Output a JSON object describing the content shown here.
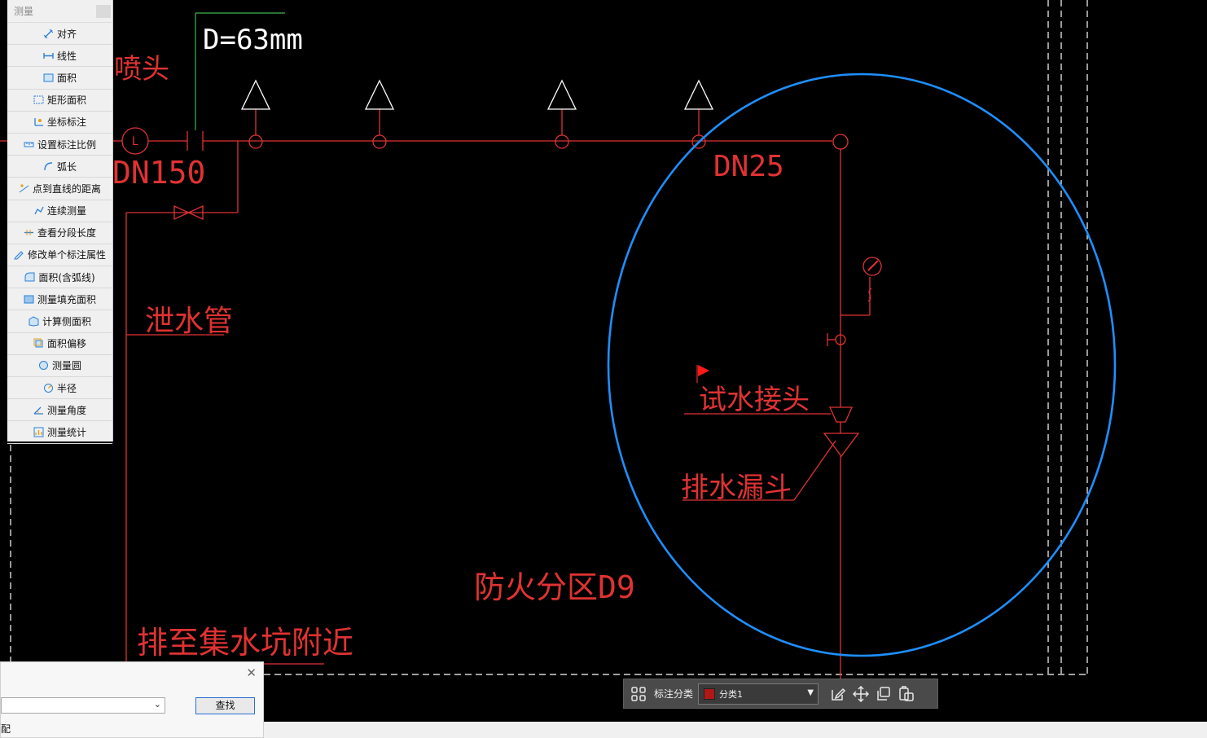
{
  "drawing": {
    "label_diameter": "D=63mm",
    "label_dn150": "DN150",
    "label_dn25": "DN25",
    "label_sprinkler": "喷头",
    "label_drain_pipe": "泄水管",
    "label_test_connector": "试水接头",
    "label_drain_funnel": "排水漏斗",
    "label_fire_zone": "防火分区D9",
    "label_to_sump": "排至集水坑附近",
    "label_L": "L",
    "colors": {
      "pipe": "#e03232",
      "highlight_circle": "#1e8fff",
      "leader": "#3cb44b",
      "frame_dashes": "#ffffff"
    }
  },
  "measure_panel": {
    "title": "测量",
    "items": [
      {
        "label": "对齐",
        "icon": "align-measure-icon"
      },
      {
        "label": "线性",
        "icon": "linear-measure-icon"
      },
      {
        "label": "面积",
        "icon": "area-icon"
      },
      {
        "label": "矩形面积",
        "icon": "rect-area-icon"
      },
      {
        "label": "坐标标注",
        "icon": "coordinate-icon"
      },
      {
        "label": "设置标注比例",
        "icon": "scale-icon"
      },
      {
        "label": "弧长",
        "icon": "arc-length-icon"
      },
      {
        "label": "点到直线的距离",
        "icon": "point-line-distance-icon"
      },
      {
        "label": "连续测量",
        "icon": "continuous-measure-icon"
      },
      {
        "label": "查看分段长度",
        "icon": "segment-length-icon"
      },
      {
        "label": "修改单个标注属性",
        "icon": "edit-annotation-icon"
      },
      {
        "label": "面积(含弧线)",
        "icon": "arc-area-icon"
      },
      {
        "label": "测量填充面积",
        "icon": "fill-area-icon"
      },
      {
        "label": "计算侧面积",
        "icon": "side-area-icon"
      },
      {
        "label": "面积偏移",
        "icon": "area-offset-icon"
      },
      {
        "label": "测量圆",
        "icon": "circle-measure-icon"
      },
      {
        "label": "半径",
        "icon": "radius-icon"
      },
      {
        "label": "测量角度",
        "icon": "angle-icon"
      },
      {
        "label": "测量统计",
        "icon": "statistics-icon"
      }
    ]
  },
  "find_dialog": {
    "find_button": "查找",
    "match_label": "配",
    "close_glyph": "✕",
    "select_value": ""
  },
  "annotation_toolbar": {
    "category_label": "标注分类",
    "category_value": "分类1",
    "swatch_color": "#b01818",
    "icons": [
      "grid-icon",
      "edit-icon",
      "move-icon",
      "copy-icon",
      "paste-icon"
    ]
  }
}
